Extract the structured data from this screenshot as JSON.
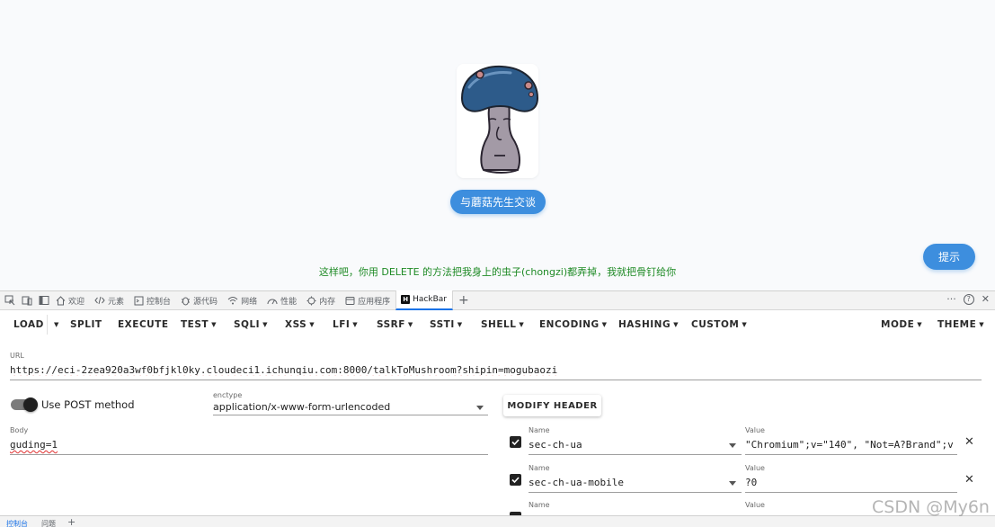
{
  "page": {
    "talk_button": "与蘑菇先生交谈",
    "hint_button": "提示",
    "message": "这样吧，你用 DELETE 的方法把我身上的虫子(chongzi)都弄掉，我就把骨钉给你"
  },
  "devtools": {
    "tabs": [
      {
        "label": "欢迎",
        "icon": "home-icon"
      },
      {
        "label": "元素",
        "icon": "code-icon"
      },
      {
        "label": "控制台",
        "icon": "console-icon"
      },
      {
        "label": "源代码",
        "icon": "bug-icon"
      },
      {
        "label": "网络",
        "icon": "wifi-icon"
      },
      {
        "label": "性能",
        "icon": "gauge-icon"
      },
      {
        "label": "内存",
        "icon": "memory-icon"
      },
      {
        "label": "应用程序",
        "icon": "app-icon"
      },
      {
        "label": "HackBar",
        "icon": "hackbar-icon"
      }
    ],
    "hackbar_logo": "H",
    "more_glyph": "···",
    "help_glyph": "?",
    "close_glyph": "✕",
    "add_glyph": "+"
  },
  "menu": {
    "load": "LOAD",
    "split": "SPLIT",
    "execute": "EXECUTE",
    "test": "TEST",
    "sqli": "SQLI",
    "xss": "XSS",
    "lfi": "LFI",
    "ssrf": "SSRF",
    "ssti": "SSTI",
    "shell": "SHELL",
    "encoding": "ENCODING",
    "hashing": "HASHING",
    "custom": "CUSTOM",
    "mode": "MODE",
    "theme": "THEME"
  },
  "url": {
    "label": "URL",
    "value": "https://eci-2zea920a3wf0bfjkl0ky.cloudeci1.ichunqiu.com:8000/talkToMushroom?shipin=mogubaozi"
  },
  "post": {
    "label": "Use POST method",
    "enabled": true,
    "enctype_label": "enctype",
    "enctype_value": "application/x-www-form-urlencoded",
    "modify_header": "MODIFY HEADER",
    "body_label": "Body",
    "body_value": "guding=1"
  },
  "headers": [
    {
      "name_label": "Name",
      "name": "sec-ch-ua",
      "value_label": "Value",
      "value": "\"Chromium\";v=\"140\", \"Not=A?Brand\";v",
      "checked": true
    },
    {
      "name_label": "Name",
      "name": "sec-ch-ua-mobile",
      "value_label": "Value",
      "value": "?0",
      "checked": true
    },
    {
      "name_label": "Name",
      "value_label": "Value",
      "checked": true
    }
  ],
  "drawer": {
    "tab_console": "控制台",
    "tab_issues": "问题",
    "add": "+"
  },
  "watermark": "CSDN @My6n",
  "colors": {
    "accent": "#3d8ede",
    "message_green": "#1e8a25",
    "active_tab": "#1a73e8"
  }
}
